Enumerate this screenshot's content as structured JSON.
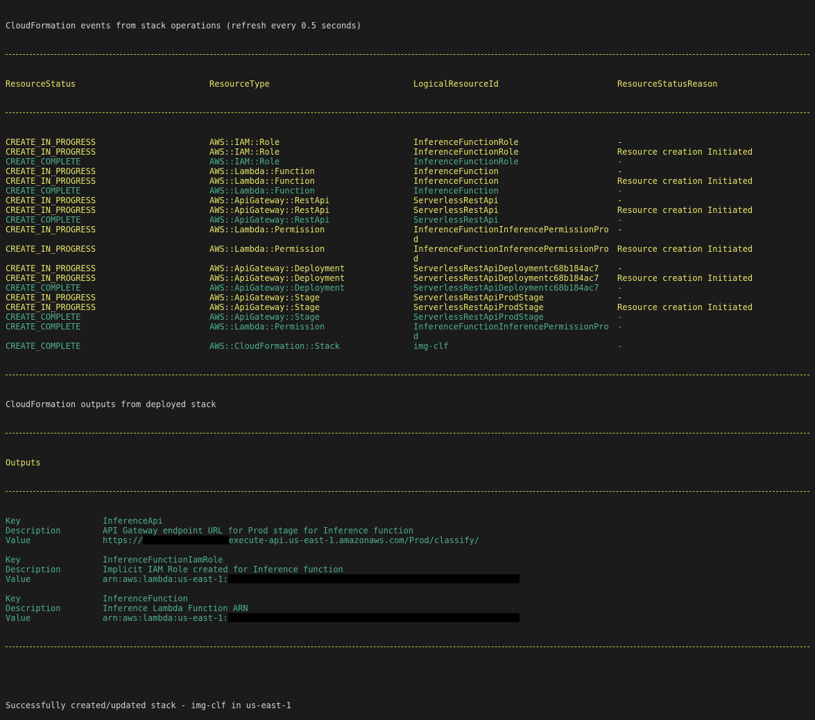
{
  "colors": {
    "background": "#1b1b1b",
    "in_progress": "#e5e36a",
    "complete": "#4fb08c",
    "plain": "#d4d4d4",
    "rule": "#c8c64a"
  },
  "events": {
    "title": "CloudFormation events from stack operations (refresh every 0.5 seconds)",
    "headers": [
      "ResourceStatus",
      "ResourceType",
      "LogicalResourceId",
      "ResourceStatusReason"
    ],
    "rows": [
      {
        "status": "CREATE_IN_PROGRESS",
        "type": "AWS::IAM::Role",
        "id": "InferenceFunctionRole",
        "id2": "",
        "reason": "-"
      },
      {
        "status": "CREATE_IN_PROGRESS",
        "type": "AWS::IAM::Role",
        "id": "InferenceFunctionRole",
        "id2": "",
        "reason": "Resource creation Initiated"
      },
      {
        "status": "CREATE_COMPLETE",
        "type": "AWS::IAM::Role",
        "id": "InferenceFunctionRole",
        "id2": "",
        "reason": "-"
      },
      {
        "status": "CREATE_IN_PROGRESS",
        "type": "AWS::Lambda::Function",
        "id": "InferenceFunction",
        "id2": "",
        "reason": "-"
      },
      {
        "status": "CREATE_IN_PROGRESS",
        "type": "AWS::Lambda::Function",
        "id": "InferenceFunction",
        "id2": "",
        "reason": "Resource creation Initiated"
      },
      {
        "status": "CREATE_COMPLETE",
        "type": "AWS::Lambda::Function",
        "id": "InferenceFunction",
        "id2": "",
        "reason": "-"
      },
      {
        "status": "CREATE_IN_PROGRESS",
        "type": "AWS::ApiGateway::RestApi",
        "id": "ServerlessRestApi",
        "id2": "",
        "reason": "-"
      },
      {
        "status": "CREATE_IN_PROGRESS",
        "type": "AWS::ApiGateway::RestApi",
        "id": "ServerlessRestApi",
        "id2": "",
        "reason": "Resource creation Initiated"
      },
      {
        "status": "CREATE_COMPLETE",
        "type": "AWS::ApiGateway::RestApi",
        "id": "ServerlessRestApi",
        "id2": "",
        "reason": "-"
      },
      {
        "status": "CREATE_IN_PROGRESS",
        "type": "AWS::Lambda::Permission",
        "id": "InferenceFunctionInferencePermissionPro",
        "id2": "d",
        "reason": "-"
      },
      {
        "status": "CREATE_IN_PROGRESS",
        "type": "AWS::Lambda::Permission",
        "id": "InferenceFunctionInferencePermissionPro",
        "id2": "d",
        "reason": "Resource creation Initiated"
      },
      {
        "status": "CREATE_IN_PROGRESS",
        "type": "AWS::ApiGateway::Deployment",
        "id": "ServerlessRestApiDeploymentc68b184ac7",
        "id2": "",
        "reason": "-"
      },
      {
        "status": "CREATE_IN_PROGRESS",
        "type": "AWS::ApiGateway::Deployment",
        "id": "ServerlessRestApiDeploymentc68b184ac7",
        "id2": "",
        "reason": "Resource creation Initiated"
      },
      {
        "status": "CREATE_COMPLETE",
        "type": "AWS::ApiGateway::Deployment",
        "id": "ServerlessRestApiDeploymentc68b184ac7",
        "id2": "",
        "reason": "-"
      },
      {
        "status": "CREATE_IN_PROGRESS",
        "type": "AWS::ApiGateway::Stage",
        "id": "ServerlessRestApiProdStage",
        "id2": "",
        "reason": "-"
      },
      {
        "status": "CREATE_IN_PROGRESS",
        "type": "AWS::ApiGateway::Stage",
        "id": "ServerlessRestApiProdStage",
        "id2": "",
        "reason": "Resource creation Initiated"
      },
      {
        "status": "CREATE_COMPLETE",
        "type": "AWS::ApiGateway::Stage",
        "id": "ServerlessRestApiProdStage",
        "id2": "",
        "reason": "-"
      },
      {
        "status": "CREATE_COMPLETE",
        "type": "AWS::Lambda::Permission",
        "id": "InferenceFunctionInferencePermissionPro",
        "id2": "d",
        "reason": "-"
      },
      {
        "status": "CREATE_COMPLETE",
        "type": "AWS::CloudFormation::Stack",
        "id": "img-clf",
        "id2": "",
        "reason": "-"
      }
    ]
  },
  "outputs": {
    "title": "CloudFormation outputs from deployed stack",
    "header": "Outputs",
    "labels": {
      "key": "Key",
      "description": "Description",
      "value": "Value"
    },
    "entries": [
      {
        "key": "InferenceApi",
        "description": "API Gateway endpoint URL for Prod stage for Inference function",
        "value_prefix": "https://",
        "value_suffix": "execute-api.us-east-1.amazonaws.com/Prod/classify/"
      },
      {
        "key": "InferenceFunctionIamRole",
        "description": "Implicit IAM Role created for Inference function",
        "value_prefix": "arn:aws:lambda:us-east-1:",
        "value_suffix": ""
      },
      {
        "key": "InferenceFunction",
        "description": "Inference Lambda Function ARN",
        "value_prefix": "arn:aws:lambda:us-east-1:",
        "value_suffix": ""
      }
    ]
  },
  "footer": {
    "message": "Successfully created/updated stack - img-clf in us-east-1"
  }
}
